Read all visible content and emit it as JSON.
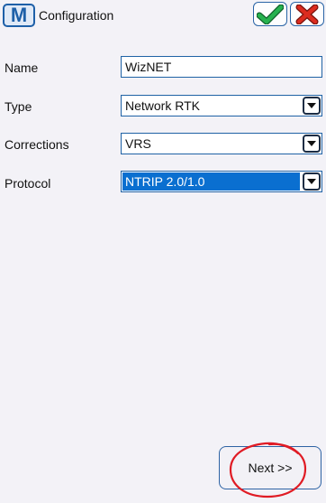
{
  "header": {
    "logo_letter": "M",
    "title": "Configuration",
    "ok_icon": "check-icon",
    "cancel_icon": "close-icon"
  },
  "form": {
    "name": {
      "label": "Name",
      "value": "WizNET"
    },
    "type": {
      "label": "Type",
      "value": "Network RTK"
    },
    "corrections": {
      "label": "Corrections",
      "value": "VRS"
    },
    "protocol": {
      "label": "Protocol",
      "value": "NTRIP 2.0/1.0"
    }
  },
  "footer": {
    "next_label": "Next >>"
  },
  "colors": {
    "accent": "#1f62a5",
    "ok_green": "#1fa64a",
    "cancel_red": "#d52a1e",
    "selection": "#0a6fd0",
    "annotation_red": "#e01b24"
  }
}
